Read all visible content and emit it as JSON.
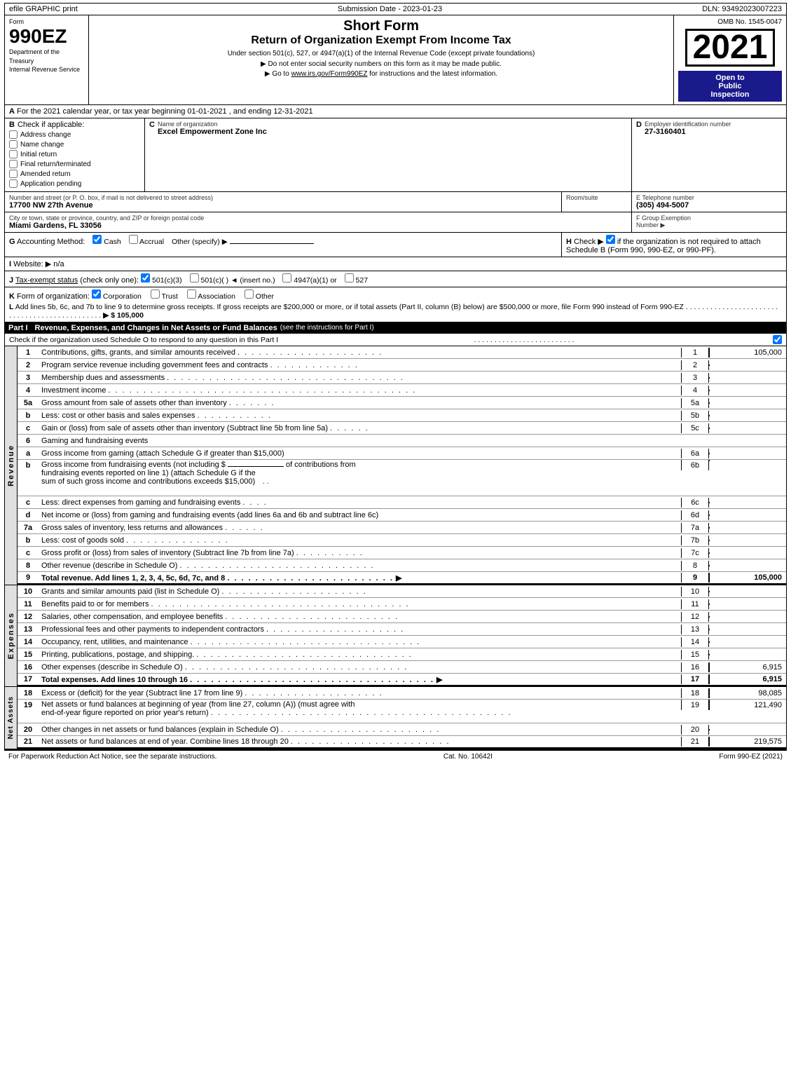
{
  "topbar": {
    "efile": "efile GRAPHIC print",
    "submission": "Submission Date - 2023-01-23",
    "dln": "DLN: 93492023007223"
  },
  "header": {
    "form_label": "Form",
    "form_number": "990EZ",
    "title1": "Short Form",
    "title2": "Return of Organization Exempt From Income Tax",
    "subtitle": "Under section 501(c), 527, or 4947(a)(1) of the Internal Revenue Code (except private foundations)",
    "instruction1": "▶ Do not enter social security numbers on this form as it may be made public.",
    "instruction2": "▶ Go to",
    "link": "www.irs.gov/Form990EZ",
    "instruction2b": "for instructions and the latest information.",
    "omb": "OMB No. 1545-0047",
    "year": "2021",
    "open_public": "Open to\nPublic\nInspection",
    "dept": "Department of the Treasury",
    "irs": "Internal Revenue Service"
  },
  "section_a": {
    "label": "A",
    "text": "For the 2021 calendar year, or tax year beginning 01-01-2021 , and ending 12-31-2021"
  },
  "section_b": {
    "label": "B",
    "title": "Check if applicable:",
    "items": [
      {
        "id": "address_change",
        "label": "Address change",
        "checked": false
      },
      {
        "id": "name_change",
        "label": "Name change",
        "checked": false
      },
      {
        "id": "initial_return",
        "label": "Initial return",
        "checked": false
      },
      {
        "id": "final_return",
        "label": "Final return/terminated",
        "checked": false
      },
      {
        "id": "amended_return",
        "label": "Amended return",
        "checked": false
      },
      {
        "id": "app_pending",
        "label": "Application pending",
        "checked": false
      }
    ]
  },
  "section_c": {
    "label": "C",
    "org_name_label": "Name of organization",
    "org_name": "Excel Empowerment Zone Inc"
  },
  "section_d": {
    "label": "D",
    "title": "Employer identification number",
    "ein": "27-3160401"
  },
  "address": {
    "label": "Number and street (or P. O. box, if mail is not delivered to street address)",
    "value": "17700 NW 27th Avenue",
    "room_label": "Room/suite",
    "room_value": "",
    "phone_label": "E Telephone number",
    "phone_value": "(305) 494-5007"
  },
  "city": {
    "label": "City or town, state or province, country, and ZIP or foreign postal code",
    "value": "Miami Gardens, FL  33056",
    "fgroup_label": "F Group Exemption",
    "fgroup_label2": "Number",
    "fgroup_arrow": "▶"
  },
  "section_g": {
    "label": "G",
    "text": "Accounting Method:",
    "cash_checked": true,
    "cash_label": "Cash",
    "accrual_checked": false,
    "accrual_label": "Accrual",
    "other_label": "Other (specify) ▶",
    "other_value": ""
  },
  "section_h": {
    "label": "H",
    "text": "Check ▶",
    "checked": true,
    "desc": "if the organization is not required to attach Schedule B (Form 990, 990-EZ, or 990-PF)."
  },
  "section_i": {
    "label": "I",
    "text": "Website: ▶",
    "value": "n/a"
  },
  "section_j": {
    "label": "J",
    "text": "Tax-exempt status (check only one):",
    "options": [
      {
        "label": "501(c)(3)",
        "checked": true
      },
      {
        "label": "501(c)(  )",
        "checked": false,
        "insert": "(insert no.)"
      },
      {
        "label": "4947(a)(1) or",
        "checked": false
      },
      {
        "label": "527",
        "checked": false
      }
    ]
  },
  "section_k": {
    "label": "K",
    "text": "Form of organization:",
    "options": [
      {
        "label": "Corporation",
        "checked": true
      },
      {
        "label": "Trust",
        "checked": false
      },
      {
        "label": "Association",
        "checked": false
      },
      {
        "label": "Other",
        "checked": false
      }
    ]
  },
  "section_l": {
    "label": "L",
    "text": "Add lines 5b, 6c, and 7b to line 9 to determine gross receipts. If gross receipts are $200,000 or more, or if total assets (Part II, column (B) below) are $500,000 or more, file Form 990 instead of Form 990-EZ",
    "dots": ". . . . . . . . . . . . . . . . . . . . . . . . . . . . . . . . . . . . . . . . . . . . . .",
    "arrow": "▶ $",
    "value": "105,000"
  },
  "part1": {
    "label": "Part I",
    "title": "Revenue, Expenses, and Changes in Net Assets or Fund Balances",
    "see_instructions": "(see the instructions for Part I)",
    "check_text": "Check if the organization used Schedule O to respond to any question in this Part I",
    "dots_check": ". . . . . . . . . . . . . . . . . . . . . . . . .",
    "checkbox_checked": true,
    "lines": [
      {
        "num": "1",
        "desc": "Contributions, gifts, grants, and similar amounts received",
        "dots": ". . . . . . . . . . . . . . . . . . . . .",
        "box_label": "1",
        "value": "105,000"
      },
      {
        "num": "2",
        "desc": "Program service revenue including government fees and contracts",
        "dots": ". . . . . . . . . . . . .",
        "box_label": "2",
        "value": ""
      },
      {
        "num": "3",
        "desc": "Membership dues and assessments",
        "dots": ". . . . . . . . . . . . . . . . . . . . . . . . . . . . . . . . . .",
        "box_label": "3",
        "value": ""
      },
      {
        "num": "4",
        "desc": "Investment income",
        "dots": ". . . . . . . . . . . . . . . . . . . . . . . . . . . . . . . . . . . . . . . . . . . .",
        "box_label": "4",
        "value": ""
      },
      {
        "num": "5a",
        "desc": "Gross amount from sale of assets other than inventory",
        "dots": ". . . . . . .",
        "box_label": "5a",
        "value": "",
        "sub": true
      },
      {
        "num": "b",
        "desc": "Less: cost or other basis and sales expenses",
        "dots": ". . . . . . . . . . .",
        "box_label": "5b",
        "value": "",
        "sub": true
      },
      {
        "num": "c",
        "desc": "Gain or (loss) from sale of assets other than inventory (Subtract line 5b from line 5a)",
        "dots": ". . . . . .",
        "box_label": "5c",
        "value": ""
      },
      {
        "num": "6",
        "desc": "Gaming and fundraising events",
        "dots": "",
        "box_label": "",
        "value": "",
        "header": true
      },
      {
        "num": "a",
        "desc": "Gross income from gaming (attach Schedule G if greater than $15,000)",
        "dots": "",
        "box_label": "6a",
        "value": "",
        "sub": true
      },
      {
        "num": "b",
        "desc": "Gross income from fundraising events (not including $",
        "dots": "",
        "box_label": "",
        "value": "",
        "sub": true,
        "continued": "of contributions from\nfundraising events reported on line 1) (attach Schedule G if the\nsum of such gross income and contributions exceeds $15,000)",
        "sub_box": "6b"
      },
      {
        "num": "c",
        "desc": "Less: direct expenses from gaming and fundraising events",
        "dots": ". . . .",
        "box_label": "6c",
        "value": "",
        "sub": true
      },
      {
        "num": "d",
        "desc": "Net income or (loss) from gaming and fundraising events (add lines 6a and 6b and subtract line 6c)",
        "dots": "",
        "box_label": "6d",
        "value": ""
      },
      {
        "num": "7a",
        "desc": "Gross sales of inventory, less returns and allowances",
        "dots": ". . . . . .",
        "box_label": "7a",
        "value": "",
        "sub": true
      },
      {
        "num": "b",
        "desc": "Less: cost of goods sold",
        "dots": ". . . . . . . . . . . . . . . .",
        "box_label": "7b",
        "value": "",
        "sub": true
      },
      {
        "num": "c",
        "desc": "Gross profit or (loss) from sales of inventory (Subtract line 7b from line 7a)",
        "dots": ". . . . . . . . . .",
        "box_label": "7c",
        "value": ""
      },
      {
        "num": "8",
        "desc": "Other revenue (describe in Schedule O)",
        "dots": ". . . . . . . . . . . . . . . . . . . . . . . . . . . .",
        "box_label": "8",
        "value": ""
      },
      {
        "num": "9",
        "desc": "Total revenue. Add lines 1, 2, 3, 4, 5c, 6d, 7c, and 8",
        "dots": ". . . . . . . . . . . . . . . . . . . . . . . .",
        "arrow": "▶",
        "box_label": "9",
        "value": "105,000",
        "bold": true
      }
    ]
  },
  "expenses": {
    "lines": [
      {
        "num": "10",
        "desc": "Grants and similar amounts paid (list in Schedule O)",
        "dots": ". . . . . . . . . . . . . . . . . . . . .",
        "box_label": "10",
        "value": ""
      },
      {
        "num": "11",
        "desc": "Benefits paid to or for members",
        "dots": ". . . . . . . . . . . . . . . . . . . . . . . . . . . . . . . . . . . . .",
        "box_label": "11",
        "value": ""
      },
      {
        "num": "12",
        "desc": "Salaries, other compensation, and employee benefits",
        "dots": ". . . . . . . . . . . . . . . . . . . . . . . . .",
        "box_label": "12",
        "value": ""
      },
      {
        "num": "13",
        "desc": "Professional fees and other payments to independent contractors",
        "dots": ". . . . . . . . . . . . . . . . . . . .",
        "box_label": "13",
        "value": ""
      },
      {
        "num": "14",
        "desc": "Occupancy, rent, utilities, and maintenance",
        "dots": ". . . . . . . . . . . . . . . . . . . . . . . . . . . . . . . . .",
        "box_label": "14",
        "value": ""
      },
      {
        "num": "15",
        "desc": "Printing, publications, postage, and shipping.",
        "dots": ". . . . . . . . . . . . . . . . . . . . . . . . . . . . . . . .",
        "box_label": "15",
        "value": ""
      },
      {
        "num": "16",
        "desc": "Other expenses (describe in Schedule O)",
        "dots": ". . . . . . . . . . . . . . . . . . . . . . . . . . . . . . . .",
        "box_label": "16",
        "value": "6,915"
      },
      {
        "num": "17",
        "desc": "Total expenses. Add lines 10 through 16",
        "dots": ". . . . . . . . . . . . . . . . . . . . . . . . . . . . . . . . . . .",
        "arrow": "▶",
        "box_label": "17",
        "value": "6,915",
        "bold": true
      }
    ]
  },
  "net_assets": {
    "lines": [
      {
        "num": "18",
        "desc": "Excess or (deficit) for the year (Subtract line 17 from line 9)",
        "dots": ". . . . . . . . . . . . . . . . . . . .",
        "box_label": "18",
        "value": "98,085"
      },
      {
        "num": "19",
        "desc": "Net assets or fund balances at beginning of year (from line 27, column (A)) (must agree with end-of-year figure reported on prior year's return)",
        "dots": ". . . . . . . . . . . . . . . . . . . . . . . . . . . . . . . . . . . . . . . . . . .",
        "box_label": "19",
        "value": "121,490"
      },
      {
        "num": "20",
        "desc": "Other changes in net assets or fund balances (explain in Schedule O)",
        "dots": ". . . . . . . . . . . . . . . . . . . . . . .",
        "box_label": "20",
        "value": ""
      },
      {
        "num": "21",
        "desc": "Net assets or fund balances at end of year. Combine lines 18 through 20",
        "dots": ". . . . . . . . . . . . . . . . . . . . . . .",
        "box_label": "21",
        "value": "219,575"
      }
    ]
  },
  "footer": {
    "left": "For Paperwork Reduction Act Notice, see the separate instructions.",
    "center": "Cat. No. 10642I",
    "right": "Form 990-EZ (2021)"
  }
}
